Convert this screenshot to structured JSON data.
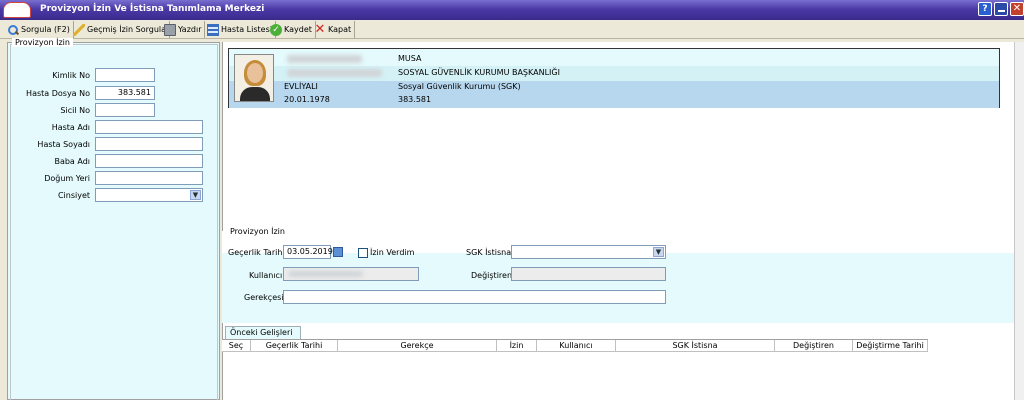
{
  "window": {
    "title": "Provizyon İzin Ve İstisna Tanımlama Merkezi",
    "help": "?",
    "close": "✕"
  },
  "toolbar": {
    "sorgula": "Sorgula (F2)",
    "gecmis": "Geçmiş İzin Sorgula",
    "yazdir": "Yazdır",
    "hasta_listesi": "Hasta Listesi",
    "kaydet": "Kaydet",
    "kapat": "Kapat"
  },
  "left": {
    "legend": "Provizyon İzin",
    "labels": {
      "kimlik_no": "Kimlik No",
      "hasta_dosya_no": "Hasta Dosya No",
      "sicil_no": "Sicil No",
      "hasta_adi": "Hasta Adı",
      "hasta_soyadi": "Hasta Soyadı",
      "baba_adi": "Baba Adı",
      "dogum_yeri": "Doğum Yeri",
      "cinsiyet": "Cinsiyet"
    },
    "values": {
      "kimlik_no": "",
      "hasta_dosya_no": "383.581",
      "sicil_no": "",
      "hasta_adi": "",
      "hasta_soyadi": "",
      "baba_adi": "",
      "dogum_yeri": "",
      "cinsiyet": ""
    }
  },
  "patient": {
    "name": "MUSA",
    "institution": "SOSYAL GÜVENLİK KURUMU BAŞKANLIĞI",
    "surname": "EVLİYALI",
    "insurance": "Sosyal Güvenlik Kurumu (SGK)",
    "birth_date": "20.01.1978",
    "file_no": "383.581"
  },
  "provizyon": {
    "legend": "Provizyon İzin",
    "gecerlik_label": "Geçerlik Tarihi",
    "gecerlik_value": "03.05.2019",
    "izin_verdim": "İzin Verdim",
    "sgk_istisna_label": "SGK İstisna",
    "kullanici_label": "Kullanıcı",
    "degistiren_label": "Değiştiren",
    "gerekce_label": "Gerekçesi"
  },
  "history": {
    "tab": "Önceki Gelişleri",
    "columns": [
      "Seç",
      "Geçerlik Tarihi",
      "Gerekçe",
      "İzin",
      "Kullanıcı",
      "SGK İstisna",
      "Değiştiren",
      "Değiştirme Tarihi"
    ]
  },
  "colors": {
    "title_bar": "#4b3aa6",
    "panel_bg": "#e4fafc",
    "card_row": "#b7d7ef"
  }
}
